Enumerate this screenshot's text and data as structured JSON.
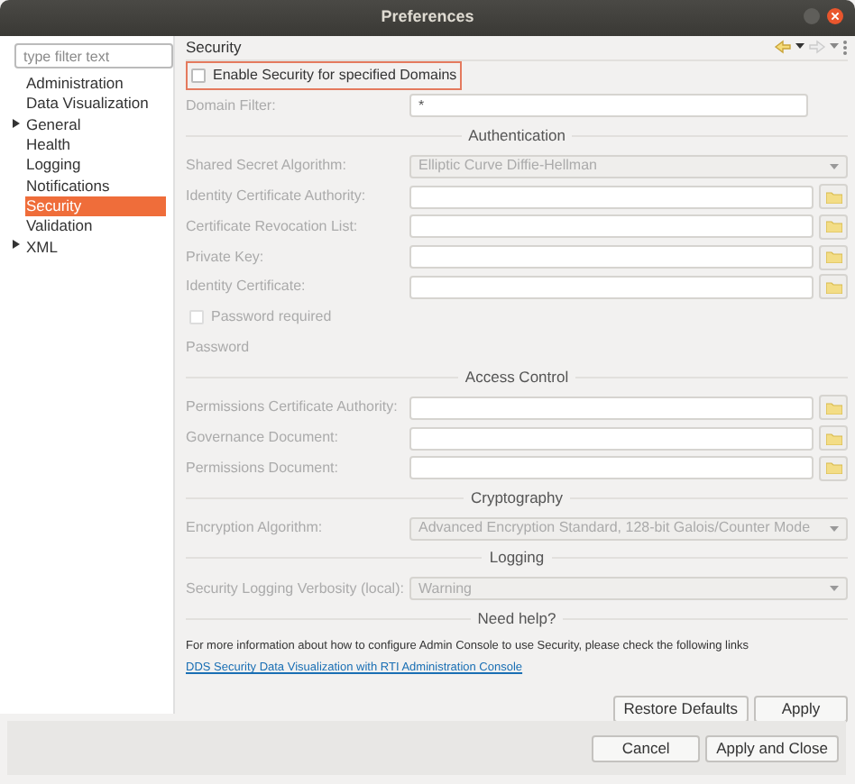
{
  "window": {
    "title": "Preferences"
  },
  "sidebar": {
    "filter": {
      "placeholder": "type filter text"
    },
    "items": [
      {
        "label": "Administration",
        "selected": false
      },
      {
        "label": "Data Visualization",
        "selected": false
      },
      {
        "label": "General",
        "selected": false,
        "expanded": false
      },
      {
        "label": "Health",
        "selected": false
      },
      {
        "label": "Logging",
        "selected": false
      },
      {
        "label": "Notifications",
        "selected": false
      },
      {
        "label": "Security",
        "selected": true
      },
      {
        "label": "Validation",
        "selected": false
      },
      {
        "label": "XML",
        "selected": false,
        "expanded": false
      }
    ]
  },
  "page": {
    "title": "Security",
    "rows": [
      {
        "kind": "checkbox",
        "label": "Enable Security for specified Domains",
        "checked": false,
        "disabled": false,
        "focused": true
      },
      {
        "kind": "text",
        "label": "Domain Filter:",
        "value": "*",
        "disabled": true
      },
      {
        "kind": "section",
        "label": "Authentication"
      },
      {
        "kind": "combo",
        "label": "Shared Secret Algorithm:",
        "value": "Elliptic Curve Diffie-Hellman",
        "disabled": true
      },
      {
        "kind": "file",
        "label": "Identity Certificate Authority:",
        "disabled": true
      },
      {
        "kind": "file",
        "label": "Certificate Revocation List:",
        "disabled": true
      },
      {
        "kind": "file",
        "label": "Private Key:",
        "disabled": true
      },
      {
        "kind": "file",
        "label": "Identity Certificate:",
        "disabled": true
      },
      {
        "kind": "checkbox",
        "label": "Password required",
        "checked": false,
        "disabled": true,
        "focused": false
      },
      {
        "kind": "label",
        "label": "Password",
        "disabled": true
      },
      {
        "kind": "section",
        "label": "Access Control"
      },
      {
        "kind": "file",
        "label": "Permissions Certificate Authority:",
        "disabled": true
      },
      {
        "kind": "file",
        "label": "Governance Document:",
        "disabled": true
      },
      {
        "kind": "file",
        "label": "Permissions Document:",
        "disabled": true
      },
      {
        "kind": "section",
        "label": "Cryptography"
      },
      {
        "kind": "combo",
        "label": "Encryption Algorithm:",
        "value": "Advanced Encryption Standard, 128-bit Galois/Counter Mode",
        "disabled": true
      },
      {
        "kind": "section",
        "label": "Logging"
      },
      {
        "kind": "combo",
        "label": "Security Logging Verbosity (local):",
        "value": "Warning",
        "disabled": true
      },
      {
        "kind": "section",
        "label": "Need help?"
      }
    ],
    "help_text": "For more information about how to configure Admin Console to use Security, please check the following links",
    "help_link": "DDS Security Data Visualization with RTI Administration Console",
    "buttons": [
      "Restore Defaults",
      "Apply"
    ]
  },
  "footer_buttons": [
    "Cancel",
    "Apply and Close"
  ]
}
